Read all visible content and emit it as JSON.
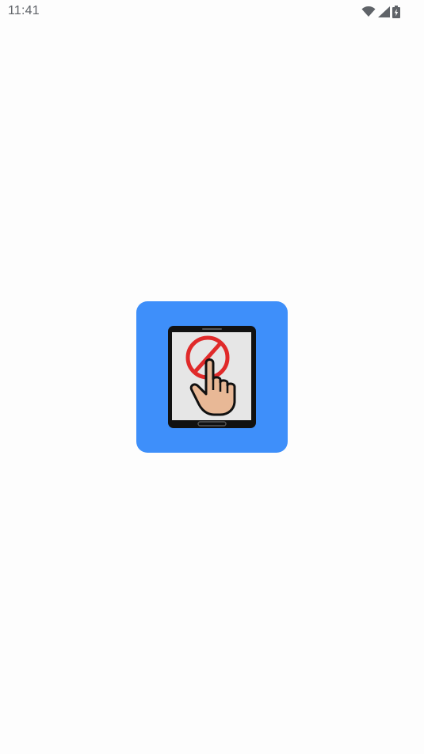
{
  "status_bar": {
    "time": "11:41",
    "icons": [
      "wifi-icon",
      "cellular-signal-icon",
      "battery-charging-icon"
    ]
  },
  "splash": {
    "icon": "app-logo-no-touch-tablet-icon",
    "background_color": "#3e8ffa"
  }
}
